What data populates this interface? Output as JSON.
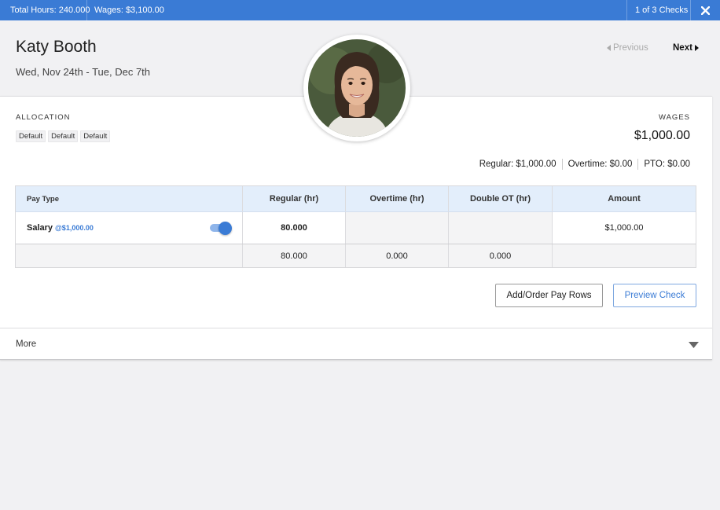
{
  "topbar": {
    "total_hours": "Total Hours: 240.000",
    "wages": "Wages: $3,100.00",
    "check_count": "1 of 3 Checks"
  },
  "employee": {
    "name": "Katy Booth",
    "period": "Wed, Nov 24th - Tue, Dec 7th"
  },
  "nav": {
    "previous": "Previous",
    "next": "Next"
  },
  "allocation": {
    "label": "ALLOCATION",
    "tags": [
      "Default",
      "Default",
      "Default"
    ]
  },
  "wages": {
    "label": "WAGES",
    "total": "$1,000.00",
    "regular": "Regular: $1,000.00",
    "overtime": "Overtime: $0.00",
    "pto": "PTO: $0.00"
  },
  "table": {
    "headers": [
      "Pay Type",
      "Regular (hr)",
      "Overtime (hr)",
      "Double OT (hr)",
      "Amount"
    ],
    "rows": [
      {
        "pay_type": "Salary",
        "rate": "@$1,000.00",
        "regular": "80.000",
        "overtime": "",
        "double_ot": "",
        "amount": "$1,000.00",
        "enabled": true
      }
    ],
    "totals": {
      "regular": "80.000",
      "overtime": "0.000",
      "double_ot": "0.000"
    }
  },
  "buttons": {
    "add_order": "Add/Order Pay Rows",
    "preview": "Preview Check"
  },
  "more": {
    "label": "More"
  },
  "colors": {
    "accent": "#3a7bd5",
    "header_row": "#e3eefb"
  },
  "icons": {
    "close": "close-icon",
    "prev": "caret-left-icon",
    "next": "caret-right-icon",
    "more": "caret-down-icon"
  }
}
